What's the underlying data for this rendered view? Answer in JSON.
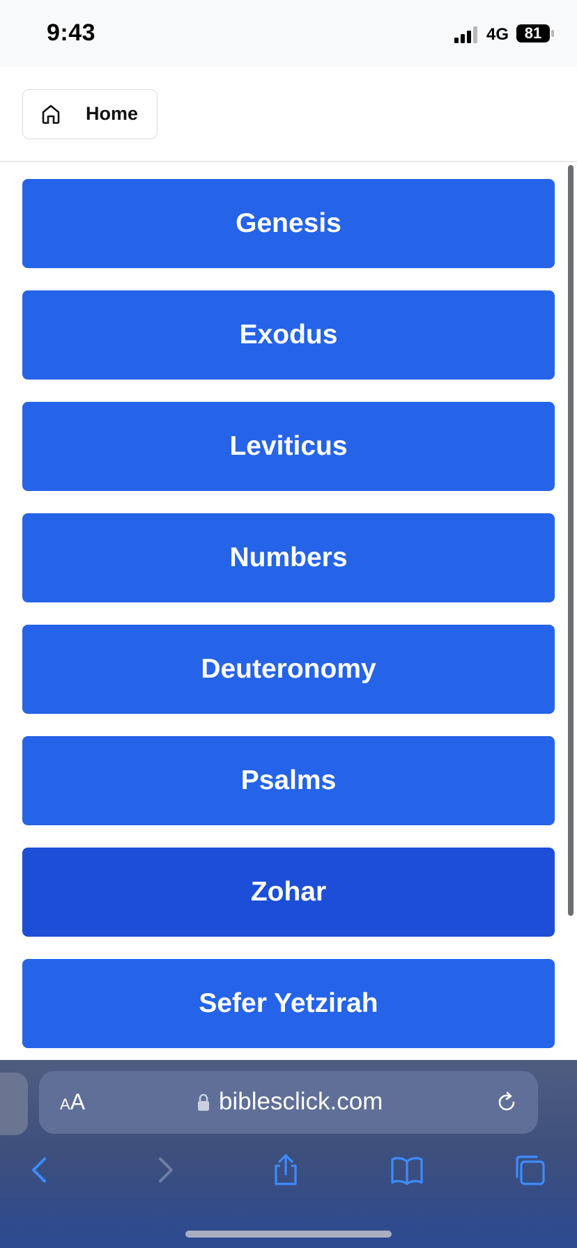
{
  "status_bar": {
    "time": "9:43",
    "network": "4G",
    "battery": "81"
  },
  "header": {
    "home_label": "Home",
    "home_icon": "house-icon"
  },
  "books": [
    {
      "label": "Genesis",
      "active": false
    },
    {
      "label": "Exodus",
      "active": false
    },
    {
      "label": "Leviticus",
      "active": false
    },
    {
      "label": "Numbers",
      "active": false
    },
    {
      "label": "Deuteronomy",
      "active": false
    },
    {
      "label": "Psalms",
      "active": false
    },
    {
      "label": "Zohar",
      "active": true
    },
    {
      "label": "Sefer Yetzirah",
      "active": false
    }
  ],
  "colors": {
    "button": "#2563e9",
    "button_active": "#1d4ed8"
  },
  "browser": {
    "text_size_label_small": "A",
    "text_size_label_large": "A",
    "url": "biblesclick.com",
    "toolbar_icons": [
      "back-icon",
      "forward-icon",
      "share-icon",
      "bookmarks-icon",
      "tabs-icon"
    ]
  }
}
